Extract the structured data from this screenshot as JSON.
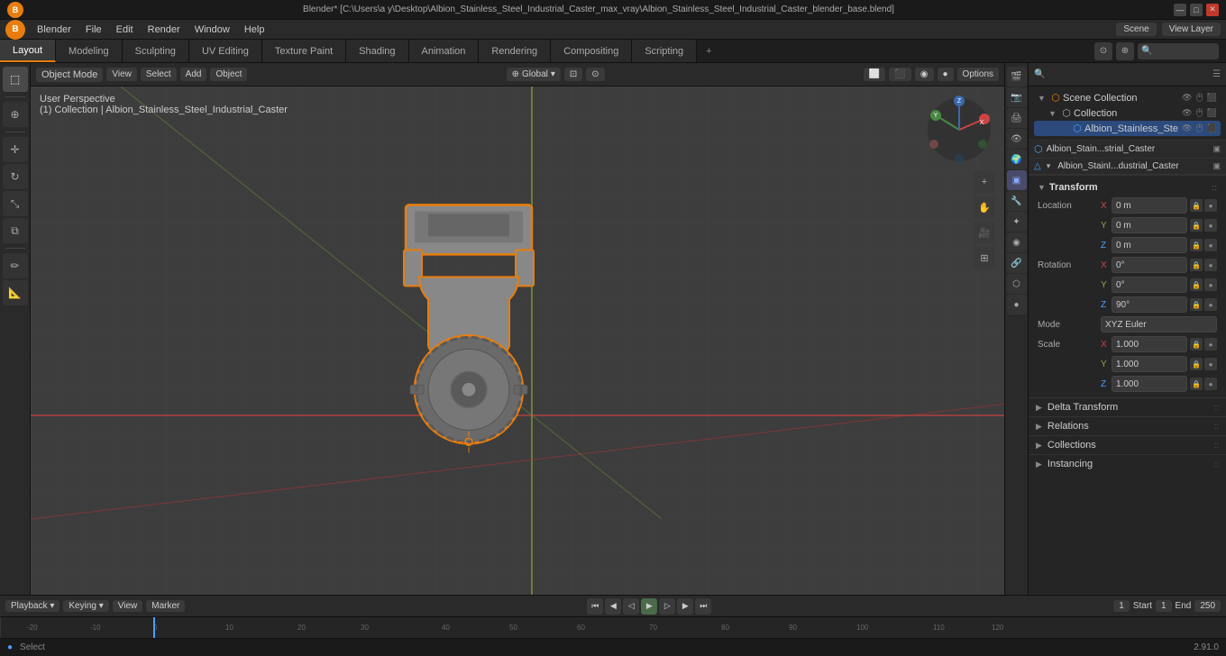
{
  "titlebar": {
    "title": "Blender* [C:\\Users\\a y\\Desktop\\Albion_Stainless_Steel_Industrial_Caster_max_vray\\Albion_Stainless_Steel_Industrial_Caster_blender_base.blend]",
    "minimize": "—",
    "maximize": "□",
    "close": "✕"
  },
  "menubar": {
    "logo": "B",
    "items": [
      "Blender",
      "File",
      "Edit",
      "Render",
      "Window",
      "Help"
    ]
  },
  "workspace_tabs": {
    "tabs": [
      "Layout",
      "Modeling",
      "Sculpting",
      "UV Editing",
      "Texture Paint",
      "Shading",
      "Animation",
      "Rendering",
      "Compositing",
      "Scripting"
    ],
    "active": "Layout",
    "add_label": "+"
  },
  "viewport_header": {
    "mode": "Object Mode",
    "view": "View",
    "select": "Select",
    "add": "Add",
    "object": "Object",
    "transform": "Global",
    "snap_icon": "⊡",
    "options": "Options"
  },
  "viewport_info": {
    "perspective": "User Perspective",
    "collection": "(1) Collection | Albion_Stainless_Steel_Industrial_Caster"
  },
  "scene_label": "Scene",
  "view_layer_label": "View Layer",
  "outliner": {
    "scene_collection": "Scene Collection",
    "collection": "Collection",
    "object_name": "Albion_Stainless_Ste"
  },
  "object_properties": {
    "object_name": "Albion_Stain...strial_Caster",
    "data_name": "Albion_StainI...dustrial_Caster",
    "transform": "Transform",
    "location": {
      "label": "Location",
      "x_label": "X",
      "y_label": "Y",
      "z_label": "Z",
      "x_val": "0 m",
      "y_val": "0 m",
      "z_val": "0 m"
    },
    "rotation": {
      "label": "Rotation",
      "x_label": "X",
      "y_label": "Y",
      "z_label": "Z",
      "x_val": "0°",
      "y_val": "0°",
      "z_val": "90°",
      "mode_label": "Mode",
      "mode_val": "XYZ Euler"
    },
    "scale": {
      "label": "Scale",
      "x_label": "X",
      "y_label": "Y",
      "z_label": "Z",
      "x_val": "1.000",
      "y_val": "1.000",
      "z_val": "1.000"
    },
    "delta_transform": "Delta Transform",
    "relations": "Relations",
    "collections": "Collections",
    "instancing": "Instancing"
  },
  "timeline": {
    "playback": "Playback",
    "keying": "Keying",
    "view": "View",
    "marker": "Marker",
    "frame_current": "1",
    "start_label": "Start",
    "start_val": "1",
    "end_label": "End",
    "end_val": "250"
  },
  "statusbar": {
    "left": "Select",
    "version": "2.91.0",
    "checkmark": "✓"
  },
  "colors": {
    "accent": "#e87d0d",
    "active_tab_bg": "#3a3a3a",
    "viewport_bg": "#3a3a3a",
    "selected_outline": "#e87d0d",
    "grid_line": "#444",
    "axis_x": "#cc3333",
    "axis_y": "#88aa44",
    "panel_bg": "#252525",
    "sidebar_bg": "#2a2a2a"
  },
  "tools": {
    "select_icon": "⬚",
    "cursor_icon": "⊕",
    "move_icon": "✛",
    "rotate_icon": "↻",
    "scale_icon": "⤡",
    "transform_icon": "⧉",
    "annotate_icon": "✏",
    "measure_icon": "📐"
  }
}
